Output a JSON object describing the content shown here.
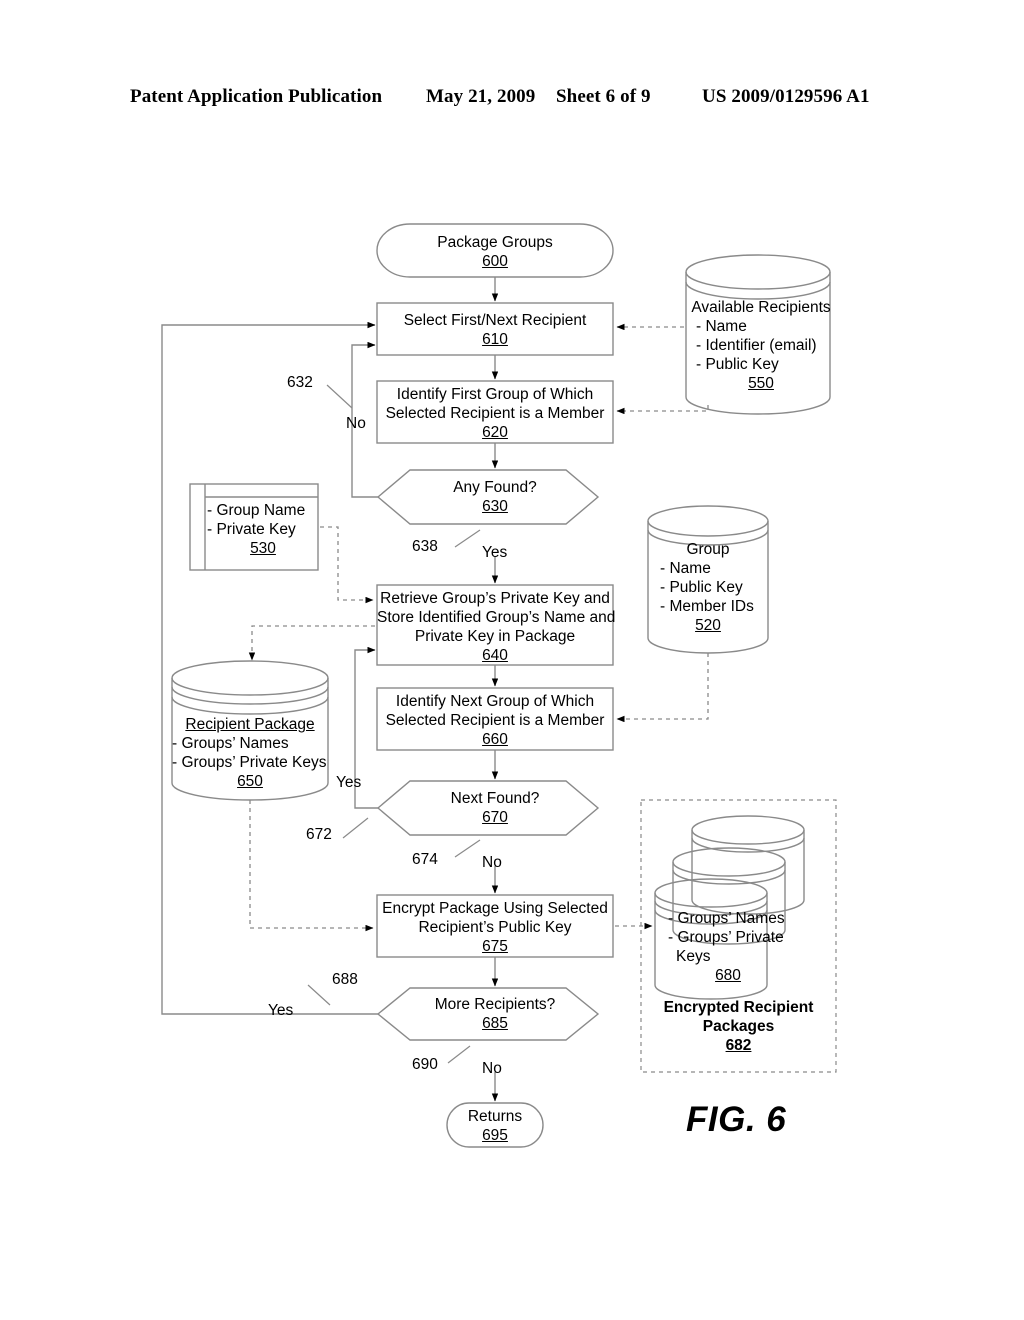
{
  "header": {
    "publication": "Patent Application Publication",
    "date": "May 21, 2009",
    "sheet": "Sheet 6 of 9",
    "number": "US 2009/0129596 A1"
  },
  "figure": {
    "label": "FIG. 6",
    "nodes": {
      "start": {
        "title": "Package Groups",
        "ref": "600",
        "shape": "terminator"
      },
      "select_recipient": {
        "title": "Select First/Next Recipient",
        "ref": "610",
        "shape": "process"
      },
      "identify_first_group": {
        "line1": "Identify First Group of Which",
        "line2": "Selected Recipient is a Member",
        "ref": "620",
        "shape": "process"
      },
      "any_found": {
        "title": "Any Found?",
        "ref": "630",
        "shape": "decision"
      },
      "retrieve_store": {
        "line1": "Retrieve Group’s Private Key and",
        "line2": "Store Identified Group’s Name and",
        "line3": "Private Key in Package",
        "ref": "640",
        "shape": "process"
      },
      "identify_next_group": {
        "line1": "Identify Next Group of Which",
        "line2": "Selected Recipient is a Member",
        "ref": "660",
        "shape": "process"
      },
      "next_found": {
        "title": "Next Found?",
        "ref": "670",
        "shape": "decision"
      },
      "encrypt_package": {
        "line1": "Encrypt Package Using Selected",
        "line2": "Recipient’s Public Key",
        "ref": "675",
        "shape": "process"
      },
      "more_recipients": {
        "title": "More Recipients?",
        "ref": "685",
        "shape": "decision"
      },
      "returns": {
        "title": "Returns",
        "ref": "695",
        "shape": "terminator"
      }
    },
    "datastores": {
      "available_recipients": {
        "title": "Available Recipients",
        "fields": [
          "- Name",
          "- Identifier (email)",
          "- Public Key"
        ],
        "ref": "550",
        "shape": "cylinder"
      },
      "group": {
        "title": "Group",
        "fields": [
          "- Name",
          "- Public Key",
          "- Member IDs"
        ],
        "ref": "520",
        "shape": "cylinder"
      },
      "group_key_card": {
        "fields": [
          "- Group Name",
          "- Private Key"
        ],
        "ref": "530",
        "shape": "document"
      },
      "recipient_package": {
        "title": "Recipient Package",
        "fields": [
          "- Groups’ Names",
          "- Groups’ Private Keys"
        ],
        "ref": "650",
        "shape": "cylinder"
      },
      "encrypted_packages": {
        "fields": [
          "- Groups’ Names",
          "- Groups’ Private",
          "Keys"
        ],
        "ref": "680",
        "caption_line1": "Encrypted Recipient",
        "caption_line2": "Packages",
        "caption_ref": "682",
        "shape": "cylinder-stack"
      }
    },
    "connector_labels": [
      {
        "id": "632",
        "text": "632"
      },
      {
        "id": "no_630",
        "text": "No"
      },
      {
        "id": "638",
        "text": "638"
      },
      {
        "id": "yes_630",
        "text": "Yes"
      },
      {
        "id": "672",
        "text": "672"
      },
      {
        "id": "yes_670",
        "text": "Yes"
      },
      {
        "id": "674",
        "text": "674"
      },
      {
        "id": "no_670",
        "text": "No"
      },
      {
        "id": "688",
        "text": "688"
      },
      {
        "id": "yes_685",
        "text": "Yes"
      },
      {
        "id": "690",
        "text": "690"
      },
      {
        "id": "no_685",
        "text": "No"
      }
    ]
  }
}
